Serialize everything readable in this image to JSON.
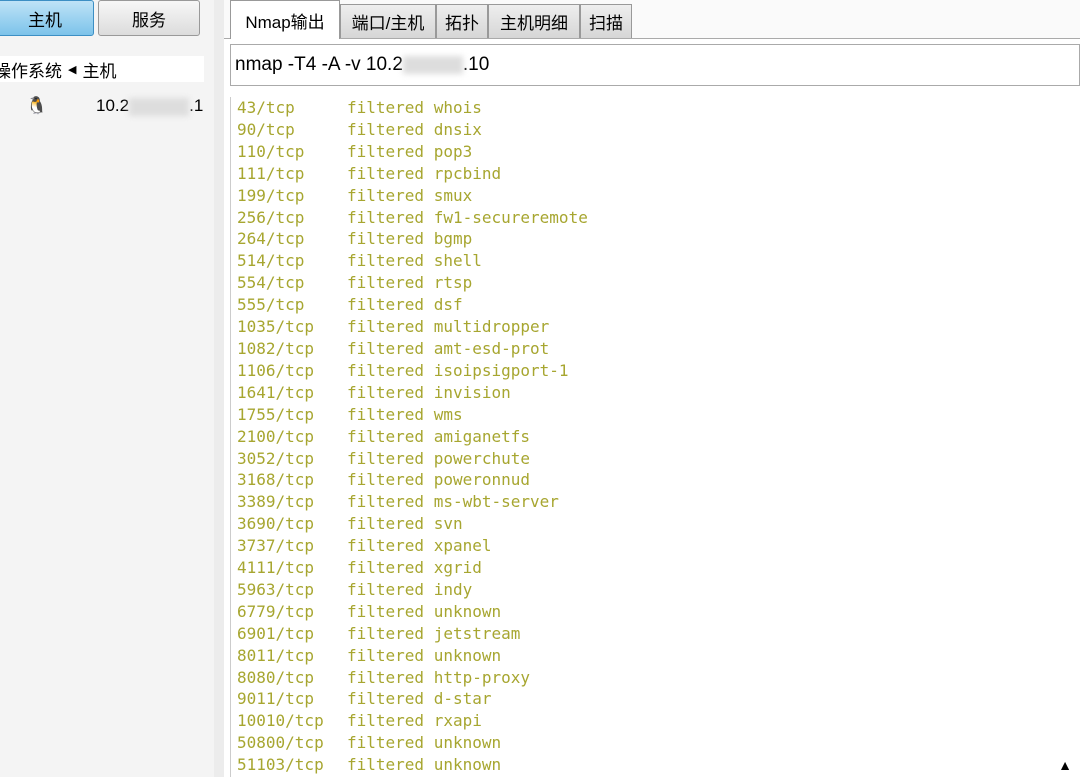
{
  "left": {
    "hosts_button": "主机",
    "services_button": "服务",
    "col_os": "操作系统",
    "col_host": "主机",
    "host_prefix": "10.2",
    "host_suffix": ".1"
  },
  "tabs": [
    "Nmap输出",
    "端口/主机",
    "拓扑",
    "主机明细",
    "扫描"
  ],
  "command": {
    "prefix": "nmap -T4 -A -v 10.2",
    "suffix": ".10"
  },
  "output": [
    [
      "43/tcp",
      "whois"
    ],
    [
      "90/tcp",
      "dnsix"
    ],
    [
      "110/tcp",
      "pop3"
    ],
    [
      "111/tcp",
      "rpcbind"
    ],
    [
      "199/tcp",
      "smux"
    ],
    [
      "256/tcp",
      "fw1-secureremote"
    ],
    [
      "264/tcp",
      "bgmp"
    ],
    [
      "514/tcp",
      "shell"
    ],
    [
      "554/tcp",
      "rtsp"
    ],
    [
      "555/tcp",
      "dsf"
    ],
    [
      "1035/tcp",
      "multidropper"
    ],
    [
      "1082/tcp",
      "amt-esd-prot"
    ],
    [
      "1106/tcp",
      "isoipsigport-1"
    ],
    [
      "1641/tcp",
      "invision"
    ],
    [
      "1755/tcp",
      "wms"
    ],
    [
      "2100/tcp",
      "amiganetfs"
    ],
    [
      "3052/tcp",
      "powerchute"
    ],
    [
      "3168/tcp",
      "poweronnud"
    ],
    [
      "3389/tcp",
      "ms-wbt-server"
    ],
    [
      "3690/tcp",
      "svn"
    ],
    [
      "3737/tcp",
      "xpanel"
    ],
    [
      "4111/tcp",
      "xgrid"
    ],
    [
      "5963/tcp",
      "indy"
    ],
    [
      "6779/tcp",
      "unknown"
    ],
    [
      "6901/tcp",
      "jetstream"
    ],
    [
      "8011/tcp",
      "unknown"
    ],
    [
      "8080/tcp",
      "http-proxy"
    ],
    [
      "9011/tcp",
      "d-star"
    ],
    [
      "10010/tcp",
      "rxapi"
    ],
    [
      "50800/tcp",
      "unknown"
    ],
    [
      "51103/tcp",
      "unknown"
    ]
  ],
  "state": "filtered",
  "warning_icon": "▲"
}
